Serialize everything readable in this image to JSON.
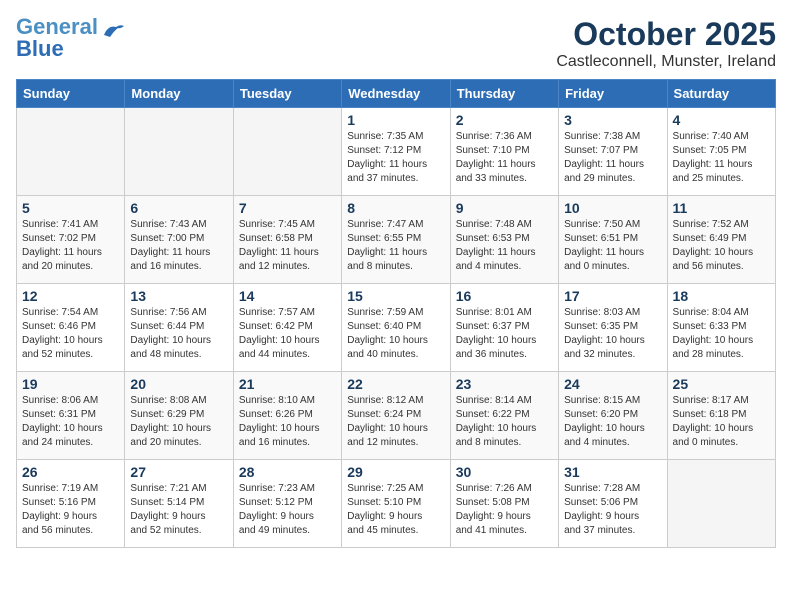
{
  "header": {
    "logo_line1": "General",
    "logo_line2": "Blue",
    "main_title": "October 2025",
    "subtitle": "Castleconnell, Munster, Ireland"
  },
  "weekdays": [
    "Sunday",
    "Monday",
    "Tuesday",
    "Wednesday",
    "Thursday",
    "Friday",
    "Saturday"
  ],
  "weeks": [
    [
      {
        "day": "",
        "info": ""
      },
      {
        "day": "",
        "info": ""
      },
      {
        "day": "",
        "info": ""
      },
      {
        "day": "1",
        "info": "Sunrise: 7:35 AM\nSunset: 7:12 PM\nDaylight: 11 hours\nand 37 minutes."
      },
      {
        "day": "2",
        "info": "Sunrise: 7:36 AM\nSunset: 7:10 PM\nDaylight: 11 hours\nand 33 minutes."
      },
      {
        "day": "3",
        "info": "Sunrise: 7:38 AM\nSunset: 7:07 PM\nDaylight: 11 hours\nand 29 minutes."
      },
      {
        "day": "4",
        "info": "Sunrise: 7:40 AM\nSunset: 7:05 PM\nDaylight: 11 hours\nand 25 minutes."
      }
    ],
    [
      {
        "day": "5",
        "info": "Sunrise: 7:41 AM\nSunset: 7:02 PM\nDaylight: 11 hours\nand 20 minutes."
      },
      {
        "day": "6",
        "info": "Sunrise: 7:43 AM\nSunset: 7:00 PM\nDaylight: 11 hours\nand 16 minutes."
      },
      {
        "day": "7",
        "info": "Sunrise: 7:45 AM\nSunset: 6:58 PM\nDaylight: 11 hours\nand 12 minutes."
      },
      {
        "day": "8",
        "info": "Sunrise: 7:47 AM\nSunset: 6:55 PM\nDaylight: 11 hours\nand 8 minutes."
      },
      {
        "day": "9",
        "info": "Sunrise: 7:48 AM\nSunset: 6:53 PM\nDaylight: 11 hours\nand 4 minutes."
      },
      {
        "day": "10",
        "info": "Sunrise: 7:50 AM\nSunset: 6:51 PM\nDaylight: 11 hours\nand 0 minutes."
      },
      {
        "day": "11",
        "info": "Sunrise: 7:52 AM\nSunset: 6:49 PM\nDaylight: 10 hours\nand 56 minutes."
      }
    ],
    [
      {
        "day": "12",
        "info": "Sunrise: 7:54 AM\nSunset: 6:46 PM\nDaylight: 10 hours\nand 52 minutes."
      },
      {
        "day": "13",
        "info": "Sunrise: 7:56 AM\nSunset: 6:44 PM\nDaylight: 10 hours\nand 48 minutes."
      },
      {
        "day": "14",
        "info": "Sunrise: 7:57 AM\nSunset: 6:42 PM\nDaylight: 10 hours\nand 44 minutes."
      },
      {
        "day": "15",
        "info": "Sunrise: 7:59 AM\nSunset: 6:40 PM\nDaylight: 10 hours\nand 40 minutes."
      },
      {
        "day": "16",
        "info": "Sunrise: 8:01 AM\nSunset: 6:37 PM\nDaylight: 10 hours\nand 36 minutes."
      },
      {
        "day": "17",
        "info": "Sunrise: 8:03 AM\nSunset: 6:35 PM\nDaylight: 10 hours\nand 32 minutes."
      },
      {
        "day": "18",
        "info": "Sunrise: 8:04 AM\nSunset: 6:33 PM\nDaylight: 10 hours\nand 28 minutes."
      }
    ],
    [
      {
        "day": "19",
        "info": "Sunrise: 8:06 AM\nSunset: 6:31 PM\nDaylight: 10 hours\nand 24 minutes."
      },
      {
        "day": "20",
        "info": "Sunrise: 8:08 AM\nSunset: 6:29 PM\nDaylight: 10 hours\nand 20 minutes."
      },
      {
        "day": "21",
        "info": "Sunrise: 8:10 AM\nSunset: 6:26 PM\nDaylight: 10 hours\nand 16 minutes."
      },
      {
        "day": "22",
        "info": "Sunrise: 8:12 AM\nSunset: 6:24 PM\nDaylight: 10 hours\nand 12 minutes."
      },
      {
        "day": "23",
        "info": "Sunrise: 8:14 AM\nSunset: 6:22 PM\nDaylight: 10 hours\nand 8 minutes."
      },
      {
        "day": "24",
        "info": "Sunrise: 8:15 AM\nSunset: 6:20 PM\nDaylight: 10 hours\nand 4 minutes."
      },
      {
        "day": "25",
        "info": "Sunrise: 8:17 AM\nSunset: 6:18 PM\nDaylight: 10 hours\nand 0 minutes."
      }
    ],
    [
      {
        "day": "26",
        "info": "Sunrise: 7:19 AM\nSunset: 5:16 PM\nDaylight: 9 hours\nand 56 minutes."
      },
      {
        "day": "27",
        "info": "Sunrise: 7:21 AM\nSunset: 5:14 PM\nDaylight: 9 hours\nand 52 minutes."
      },
      {
        "day": "28",
        "info": "Sunrise: 7:23 AM\nSunset: 5:12 PM\nDaylight: 9 hours\nand 49 minutes."
      },
      {
        "day": "29",
        "info": "Sunrise: 7:25 AM\nSunset: 5:10 PM\nDaylight: 9 hours\nand 45 minutes."
      },
      {
        "day": "30",
        "info": "Sunrise: 7:26 AM\nSunset: 5:08 PM\nDaylight: 9 hours\nand 41 minutes."
      },
      {
        "day": "31",
        "info": "Sunrise: 7:28 AM\nSunset: 5:06 PM\nDaylight: 9 hours\nand 37 minutes."
      },
      {
        "day": "",
        "info": ""
      }
    ]
  ]
}
